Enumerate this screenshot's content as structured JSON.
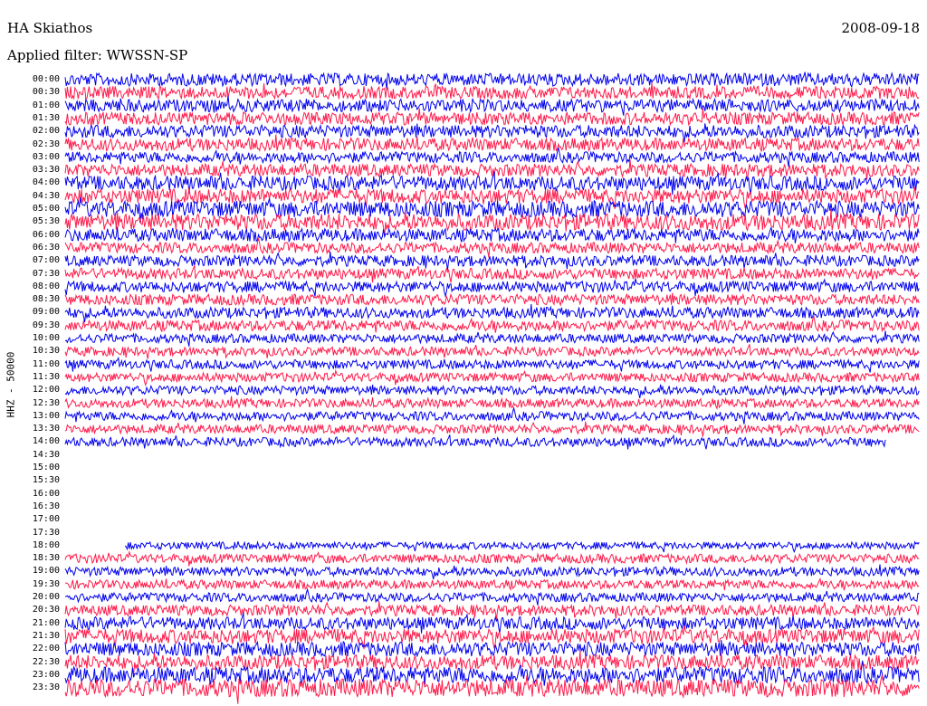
{
  "header": {
    "station": "HA Skiathos",
    "date": "2008-09-18",
    "filter": "Applied filter: WWSSN-SP"
  },
  "chart_data": {
    "type": "line",
    "title": "HA Skiathos",
    "subtitle": "Applied filter: WWSSN-SP",
    "ylabel": "HHZ - 50000",
    "xlabel": "",
    "colors": [
      "#0000ee",
      "#ff1a4a"
    ],
    "rows": [
      {
        "label": "00:00",
        "amp": 7,
        "has_data": true
      },
      {
        "label": "00:30",
        "amp": 7,
        "has_data": true
      },
      {
        "label": "01:00",
        "amp": 7,
        "has_data": true
      },
      {
        "label": "01:30",
        "amp": 7,
        "has_data": true
      },
      {
        "label": "02:00",
        "amp": 7,
        "has_data": true
      },
      {
        "label": "02:30",
        "amp": 7,
        "has_data": true
      },
      {
        "label": "03:00",
        "amp": 6,
        "has_data": true
      },
      {
        "label": "03:30",
        "amp": 7,
        "has_data": true
      },
      {
        "label": "04:00",
        "amp": 8,
        "has_data": true
      },
      {
        "label": "04:30",
        "amp": 8,
        "has_data": true
      },
      {
        "label": "05:00",
        "amp": 9,
        "has_data": true
      },
      {
        "label": "05:30",
        "amp": 9,
        "has_data": true
      },
      {
        "label": "06:00",
        "amp": 7,
        "has_data": true
      },
      {
        "label": "06:30",
        "amp": 6,
        "has_data": true
      },
      {
        "label": "07:00",
        "amp": 6,
        "has_data": true
      },
      {
        "label": "07:30",
        "amp": 6,
        "has_data": true
      },
      {
        "label": "08:00",
        "amp": 6,
        "has_data": true
      },
      {
        "label": "08:30",
        "amp": 6,
        "has_data": true
      },
      {
        "label": "09:00",
        "amp": 6,
        "has_data": true
      },
      {
        "label": "09:30",
        "amp": 6,
        "has_data": true
      },
      {
        "label": "10:00",
        "amp": 5,
        "has_data": true
      },
      {
        "label": "10:30",
        "amp": 5,
        "has_data": true
      },
      {
        "label": "11:00",
        "amp": 5,
        "has_data": true
      },
      {
        "label": "11:30",
        "amp": 5,
        "has_data": true
      },
      {
        "label": "12:00",
        "amp": 5,
        "has_data": true
      },
      {
        "label": "12:30",
        "amp": 5,
        "has_data": true
      },
      {
        "label": "13:00",
        "amp": 5,
        "has_data": true
      },
      {
        "label": "13:30",
        "amp": 5,
        "has_data": true
      },
      {
        "label": "14:00",
        "amp": 5,
        "has_data": true,
        "end_fraction": 0.96
      },
      {
        "label": "14:30",
        "amp": 0,
        "has_data": false
      },
      {
        "label": "15:00",
        "amp": 0,
        "has_data": false
      },
      {
        "label": "15:30",
        "amp": 0,
        "has_data": false
      },
      {
        "label": "16:00",
        "amp": 0,
        "has_data": false
      },
      {
        "label": "16:30",
        "amp": 0,
        "has_data": false
      },
      {
        "label": "17:00",
        "amp": 0,
        "has_data": false
      },
      {
        "label": "17:30",
        "amp": 0,
        "has_data": false
      },
      {
        "label": "18:00",
        "amp": 4,
        "has_data": true,
        "start_fraction": 0.07
      },
      {
        "label": "18:30",
        "amp": 5,
        "has_data": true
      },
      {
        "label": "19:00",
        "amp": 5,
        "has_data": true
      },
      {
        "label": "19:30",
        "amp": 5,
        "has_data": true
      },
      {
        "label": "20:00",
        "amp": 5,
        "has_data": true
      },
      {
        "label": "20:30",
        "amp": 6,
        "has_data": true
      },
      {
        "label": "21:00",
        "amp": 7,
        "has_data": true
      },
      {
        "label": "21:30",
        "amp": 8,
        "has_data": true
      },
      {
        "label": "22:00",
        "amp": 8,
        "has_data": true
      },
      {
        "label": "22:30",
        "amp": 8,
        "has_data": true
      },
      {
        "label": "23:00",
        "amp": 9,
        "has_data": true
      },
      {
        "label": "23:30",
        "amp": 10,
        "has_data": true
      }
    ]
  }
}
